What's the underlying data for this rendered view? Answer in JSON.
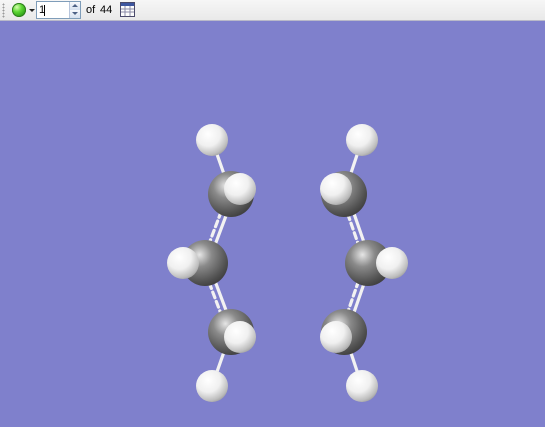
{
  "toolbar": {
    "status_icon": "green-circle-icon",
    "frame_value": "1",
    "of_label": "of",
    "frame_count": "44",
    "table_icon": "table-icon"
  },
  "viewport": {
    "background_color": "#7f80cc",
    "molecule": {
      "atom_colors": {
        "carbon": "#6e6e6e",
        "hydrogen": "#f4f4f4"
      },
      "atoms": [
        {
          "element": "H"
        },
        {
          "element": "C"
        },
        {
          "element": "H"
        },
        {
          "element": "C"
        },
        {
          "element": "H"
        },
        {
          "element": "C"
        },
        {
          "element": "H"
        },
        {
          "element": "H"
        },
        {
          "element": "H"
        },
        {
          "element": "C"
        },
        {
          "element": "H"
        },
        {
          "element": "C"
        },
        {
          "element": "H"
        },
        {
          "element": "C"
        },
        {
          "element": "H"
        },
        {
          "element": "H"
        }
      ]
    }
  }
}
